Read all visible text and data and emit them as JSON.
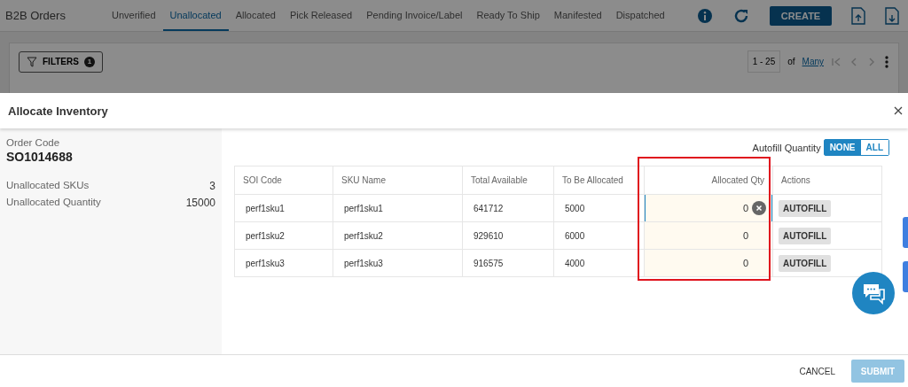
{
  "app": {
    "title": "B2B Orders",
    "tabs": [
      {
        "label": "Unverified",
        "selected": false
      },
      {
        "label": "Unallocated",
        "selected": true
      },
      {
        "label": "Allocated",
        "selected": false
      },
      {
        "label": "Pick Released",
        "selected": false
      },
      {
        "label": "Pending Invoice/Label",
        "selected": false
      },
      {
        "label": "Ready To Ship",
        "selected": false
      },
      {
        "label": "Manifested",
        "selected": false
      },
      {
        "label": "Dispatched",
        "selected": false
      }
    ],
    "create_button": "CREATE",
    "filters": {
      "label": "FILTERS",
      "count": "1"
    },
    "pagination": {
      "range": "1 - 25",
      "of": "of",
      "total": "Many"
    }
  },
  "dialog": {
    "title": "Allocate Inventory",
    "order_code_label": "Order Code",
    "order_code": "SO1014688",
    "summary": [
      {
        "label": "Unallocated SKUs",
        "value": "3"
      },
      {
        "label": "Unallocated Quantity",
        "value": "15000"
      }
    ],
    "autofill": {
      "label": "Autofill Quantity",
      "options": [
        {
          "label": "NONE",
          "selected": true
        },
        {
          "label": "ALL",
          "selected": false
        }
      ]
    },
    "table": {
      "columns": [
        "SOI Code",
        "SKU Name",
        "Total Available",
        "To Be Allocated",
        "Allocated Qty",
        "Actions"
      ],
      "rows": [
        {
          "soi_code": "perf1sku1",
          "sku_name": "perf1sku1",
          "total_available": "641712",
          "to_be_allocated": "5000",
          "allocated_qty": "0",
          "focused": true,
          "action": "AUTOFILL"
        },
        {
          "soi_code": "perf1sku2",
          "sku_name": "perf1sku2",
          "total_available": "929610",
          "to_be_allocated": "6000",
          "allocated_qty": "0",
          "focused": false,
          "action": "AUTOFILL"
        },
        {
          "soi_code": "perf1sku3",
          "sku_name": "perf1sku3",
          "total_available": "916575",
          "to_be_allocated": "4000",
          "allocated_qty": "0",
          "focused": false,
          "action": "AUTOFILL"
        }
      ]
    },
    "cancel_button": "CANCEL",
    "submit_button": {
      "label": "SUBMIT",
      "disabled": true
    }
  }
}
